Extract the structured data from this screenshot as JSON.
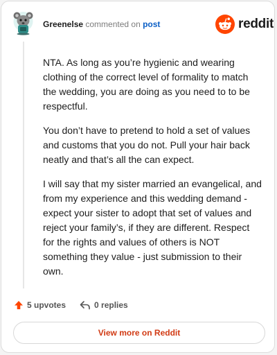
{
  "comment": {
    "author": "Greenelse",
    "action_text": " commented on ",
    "post_link": "post",
    "paragraphs": [
      "NTA. As long as you’re hygienic and wearing clothing of the correct level of formality to match the wedding, you are doing as you need to to be respectful.",
      "You don’t have to pretend to hold a set of values and customs that you do not. Pull your hair back neatly and that’s all the can expect.",
      "I will say that my sister married an evangelical, and from my experience and this wedding demand - expect your sister to adopt that set of values and reject your family’s, if they are different. Respect for the rights and values of others is NOT something they value - just submission to their own."
    ]
  },
  "brand": {
    "wordmark": "reddit",
    "color": "#ff4500"
  },
  "footer": {
    "upvotes": "5 upvotes",
    "replies": "0 replies",
    "upvote_color": "#ff4500"
  },
  "view_button": {
    "label": "View more on Reddit",
    "color": "#d13a13"
  },
  "icons": [
    "avatar",
    "reddit-logo-icon",
    "upvote-arrow-icon",
    "reply-icon"
  ]
}
